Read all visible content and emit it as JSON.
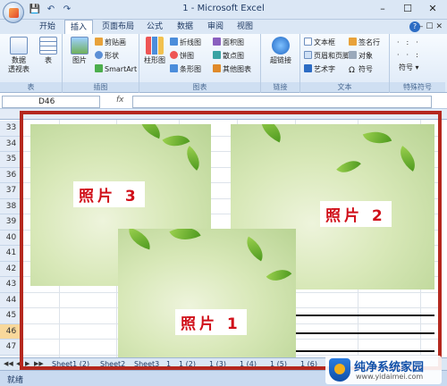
{
  "window": {
    "title": "1 - Microsoft Excel"
  },
  "qat": {
    "save": "💾",
    "undo": "↶",
    "redo": "↷"
  },
  "winbtns": {
    "min": "–",
    "max": "☐",
    "close": "✕"
  },
  "tabs": [
    "开始",
    "插入",
    "页面布局",
    "公式",
    "数据",
    "审阅",
    "视图"
  ],
  "active_tab": "插入",
  "ribbon": {
    "groups": [
      {
        "label": "表",
        "big": [
          "数据\n透视表",
          "表"
        ]
      },
      {
        "label": "插图",
        "big": [
          "图片"
        ],
        "small": [
          "剪贴画",
          "形状",
          "SmartArt"
        ]
      },
      {
        "label": "图表",
        "big": [
          "柱形图"
        ],
        "small": [
          "折线图",
          "饼图",
          "条形图",
          "面积图",
          "散点图",
          "其他图表"
        ]
      },
      {
        "label": "链接",
        "big": [
          "超链接"
        ]
      },
      {
        "label": "文本",
        "small": [
          "文本框",
          "页眉和页脚",
          "艺术字",
          "签名行",
          "对象",
          "符号"
        ]
      },
      {
        "label": "特殊符号",
        "small": [
          "符号"
        ]
      }
    ]
  },
  "formula_bar": {
    "name_box": "D46",
    "fx": "fx",
    "value": ""
  },
  "rows": [
    "33",
    "34",
    "35",
    "36",
    "37",
    "38",
    "39",
    "40",
    "41",
    "42",
    "43",
    "44",
    "45",
    "46",
    "47"
  ],
  "selected_row": "46",
  "photos": [
    {
      "label": "照片 3"
    },
    {
      "label": "照片 2"
    },
    {
      "label": "照片 1"
    }
  ],
  "sheets": [
    "Sheet1 (2)",
    "Sheet2",
    "Sheet3",
    "1",
    "1 (2)",
    "1 (3)",
    "1 (4)",
    "1 (5)",
    "1 (6)"
  ],
  "status": {
    "ready": "就绪"
  },
  "watermark": {
    "title": "纯净系统家园",
    "url": "www.yidaimei.com"
  },
  "colors": {
    "accent": "#b5281e",
    "label_text": "#d0101a"
  }
}
